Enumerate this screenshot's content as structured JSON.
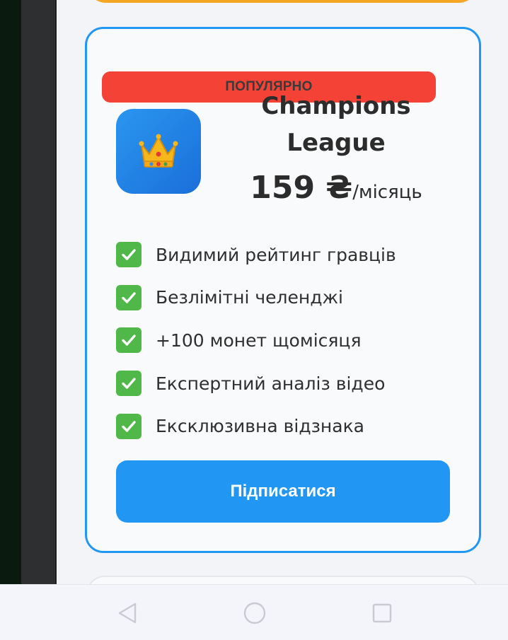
{
  "plan": {
    "badge": "ПОПУЛЯРНО",
    "title": "Champions League",
    "icon": "crown-icon",
    "price_amount": "159 ₴",
    "price_period": "/місяць",
    "features": [
      "Видимий рейтинг гравців",
      "Безлімітні челенджі",
      "+100 монет щомісяця",
      "Експертний аналіз відео",
      "Ексклюзивна відзнака"
    ],
    "subscribe_label": "Підписатися"
  },
  "colors": {
    "accent": "#2196f3",
    "badge": "#f44336",
    "previous_card_border": "#f5a623",
    "check": "#4fb848"
  },
  "navbar": {
    "icons": [
      "back-icon",
      "home-icon",
      "recents-icon"
    ]
  }
}
